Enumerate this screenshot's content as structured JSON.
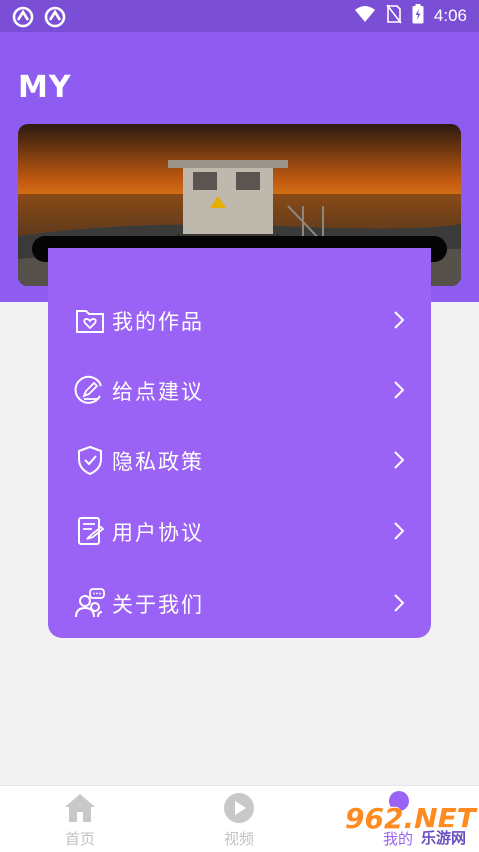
{
  "status_bar": {
    "time": "4:06"
  },
  "page_title": "MY",
  "colors": {
    "status_bar": "#7a4fd6",
    "header": "#8f5cf2",
    "card": "#9a63f5",
    "background": "#f2f2f2",
    "nav_inactive": "#c2c2c2"
  },
  "menu": [
    {
      "label": "我的作品",
      "icon": "heart-folder-icon"
    },
    {
      "label": "给点建议",
      "icon": "edit-circle-icon"
    },
    {
      "label": "隐私政策",
      "icon": "shield-check-icon"
    },
    {
      "label": "用户协议",
      "icon": "document-sign-icon"
    },
    {
      "label": "关于我们",
      "icon": "people-chat-icon"
    }
  ],
  "bottom_nav": [
    {
      "label": "首页",
      "icon": "home-icon"
    },
    {
      "label": "视频",
      "icon": "play-circle-icon"
    },
    {
      "label": "我的",
      "icon": "profile-icon"
    }
  ],
  "watermark": {
    "brand": "962.NET",
    "sub": "乐游网"
  }
}
